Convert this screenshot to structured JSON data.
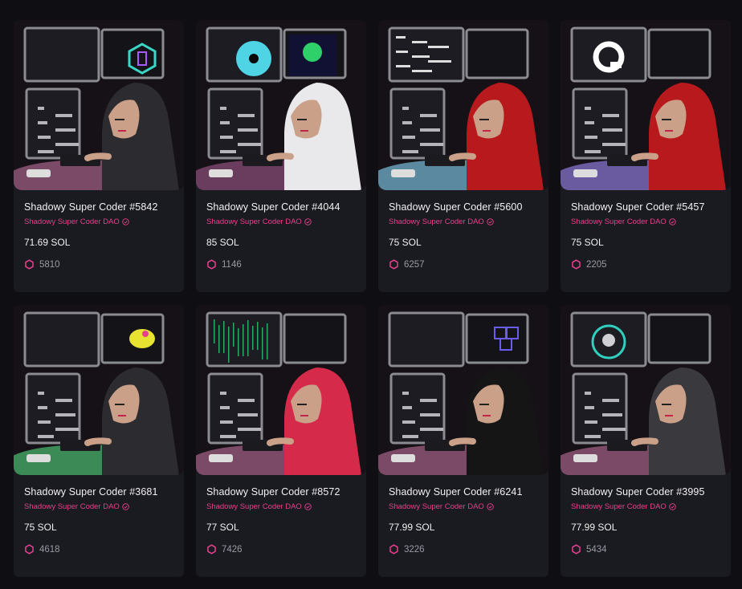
{
  "colors": {
    "background": "#0e0e13",
    "card": "#1a1a21",
    "accent": "#e8408c",
    "muted": "#9a9aa3"
  },
  "cards": [
    {
      "title": "Shadowy Super Coder #5842",
      "collection": "Shadowy Super Coder DAO",
      "price": "71.69 SOL",
      "rank": "5810",
      "hood": "#2c2c30",
      "desk": "#7a4a66",
      "monitor_icon": "hex-logo-icon",
      "glow": "#3ad7c7"
    },
    {
      "title": "Shadowy Super Coder #4044",
      "collection": "Shadowy Super Coder DAO",
      "price": "85 SOL",
      "rank": "1146",
      "hood": "#e9e9ec",
      "desk": "#6a3c5e",
      "monitor_icon": "disc-icon",
      "glow": "#4fd4e6"
    },
    {
      "title": "Shadowy Super Coder #5600",
      "collection": "Shadowy Super Coder DAO",
      "price": "75 SOL",
      "rank": "6257",
      "hood": "#b8191d",
      "desk": "#5b8aa0",
      "monitor_icon": "code-screen-icon",
      "glow": "#dddddd"
    },
    {
      "title": "Shadowy Super Coder #5457",
      "collection": "Shadowy Super Coder DAO",
      "price": "75 SOL",
      "rank": "2205",
      "hood": "#b8191d",
      "desk": "#6a5aa0",
      "monitor_icon": "q-logo-icon",
      "glow": "#ffffff"
    },
    {
      "title": "Shadowy Super Coder #3681",
      "collection": "Shadowy Super Coder DAO",
      "price": "75 SOL",
      "rank": "4618",
      "hood": "#2c2c30",
      "desk": "#3c8a55",
      "monitor_icon": "lizard-icon",
      "glow": "#e8e330"
    },
    {
      "title": "Shadowy Super Coder #8572",
      "collection": "Shadowy Super Coder DAO",
      "price": "77 SOL",
      "rank": "7426",
      "hood": "#d62a4a",
      "desk": "#7a4a66",
      "monitor_icon": "matrix-icon",
      "glow": "#2fd06a"
    },
    {
      "title": "Shadowy Super Coder #6241",
      "collection": "Shadowy Super Coder DAO",
      "price": "77.99 SOL",
      "rank": "3226",
      "hood": "#151515",
      "desk": "#7a4a66",
      "monitor_icon": "cubes-icon",
      "glow": "#6a5cf0"
    },
    {
      "title": "Shadowy Super Coder #3995",
      "collection": "Shadowy Super Coder DAO",
      "price": "77.99 SOL",
      "rank": "5434",
      "hood": "#3a3a3e",
      "desk": "#7a4a66",
      "monitor_icon": "skull-icon",
      "glow": "#2fd0c0"
    }
  ]
}
